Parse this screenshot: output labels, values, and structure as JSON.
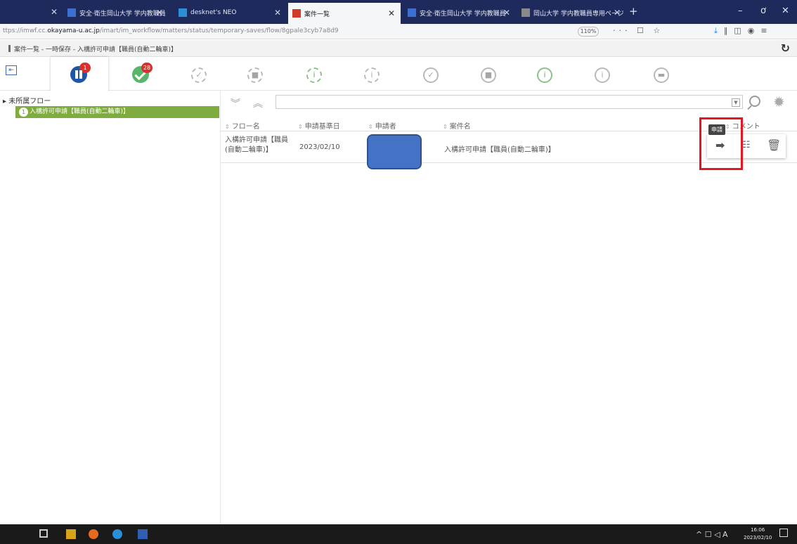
{
  "browser": {
    "tabs": [
      {
        "label": "安全·衛生岡山大学 学内教職員",
        "active": false
      },
      {
        "label": "desknet's NEO",
        "active": false
      },
      {
        "label": "案件一覧",
        "active": true
      },
      {
        "label": "安全·衛生岡山大学 学内教職員",
        "active": false
      },
      {
        "label": "岡山大学 学内教職員専用ページ",
        "active": false
      }
    ],
    "url_prefix": "ttps://imwf.cc.",
    "url_domain": "okayama-u.ac.jp",
    "url_path": "/imart/im_workflow/matters/status/temporary-saves/flow/8gpale3cyb7a8d9",
    "zoom": "110%"
  },
  "page": {
    "breadcrumb": "案件一覧 - 一時保存 - 入構許可申請【職員(自動二輪車)】"
  },
  "status_toolbar": {
    "badges": {
      "temporary_saved": "1",
      "processed": "28"
    }
  },
  "tree": {
    "root_label": "未所属フロー",
    "items": [
      {
        "count": "1",
        "label": "入構許可申請【職員(自動二輪車)】"
      }
    ]
  },
  "table": {
    "headers": [
      "フロー名",
      "申請基準日",
      "申請者",
      "案件名",
      "コメント"
    ],
    "rows": [
      {
        "flow_name": "入構許可申請【職員(自動二輪車)】",
        "base_date": "2023/02/10",
        "matter_name": "入構許可申請【職員(自動二輪車)】"
      }
    ]
  },
  "actions": {
    "tooltip": "申請"
  },
  "taskbar": {
    "ime": "A",
    "time": "16:06",
    "date": "2023/02/10"
  },
  "colors": {
    "accent_blue": "#1f55a8",
    "tree_green": "#7fac3e",
    "highlight_red": "#e3171f",
    "badge_red": "#d8312c"
  }
}
